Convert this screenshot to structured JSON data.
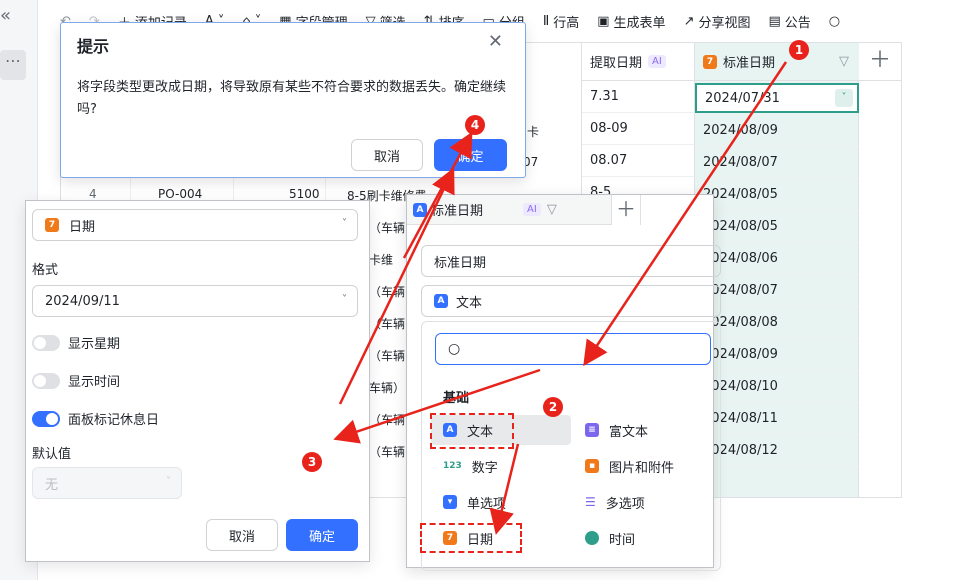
{
  "rail": {
    "collapse_icon": "«",
    "more_icon": "⋯"
  },
  "toolbar": {
    "items": [
      "添加记录",
      "字段管理",
      "筛选",
      "排序",
      "分组",
      "行高",
      "生成表单",
      "分享视图",
      "公告"
    ]
  },
  "grid": {
    "col_extract": "提取日期",
    "col_standard": "标准日期",
    "ai_tag": "AI",
    "rows": [
      {
        "extract": "7.31",
        "standard": "2024/07/31"
      },
      {
        "extract": "08-09",
        "standard": "2024/08/09"
      },
      {
        "extract": "08.07",
        "standard": "2024/08/07"
      },
      {
        "extract": "8-5",
        "standard": "2024/08/05"
      },
      {
        "extract": "",
        "standard": "2024/08/05"
      },
      {
        "extract": "",
        "standard": "2024/08/06"
      },
      {
        "extract": "",
        "standard": "2024/08/07"
      },
      {
        "extract": "",
        "standard": "2024/08/08"
      },
      {
        "extract": "",
        "standard": "2024/08/09"
      },
      {
        "extract": "",
        "standard": "2024/08/10"
      },
      {
        "extract": "",
        "standard": "2024/08/11"
      },
      {
        "extract": "",
        "standard": "2024/08/12"
      }
    ],
    "partial_row": {
      "index": "4",
      "po": "PO-004",
      "amount": "5100",
      "desc": "8-5刷卡维修费"
    },
    "partial_cells": [
      "卡",
      "07",
      "则（车辆",
      "刷卡维",
      "则（车辆",
      "则（车辆",
      "则（车辆",
      "（车辆）",
      "则（车辆",
      "则（车辆",
      "则（车辆"
    ]
  },
  "dialog": {
    "title": "提示",
    "message": "将字段类型更改成日期，将导致原有某些不符合要求的数据丢失。确定继续吗?",
    "cancel": "取消",
    "confirm": "确定"
  },
  "settings_panel": {
    "type_label": "日期",
    "format_heading": "格式",
    "format_value": "2024/09/11",
    "toggle_weekday": "显示星期",
    "toggle_time": "显示时间",
    "toggle_holiday": "面板标记休息日",
    "default_heading": "默认值",
    "default_value": "无",
    "cancel": "取消",
    "confirm": "确定"
  },
  "type_panel": {
    "header_title": "标准日期",
    "ai_tag": "AI",
    "name_value": "标准日期",
    "current_type": "文本",
    "search_placeholder": "",
    "section_basic": "基础",
    "types": {
      "text": "文本",
      "rich_text": "富文本",
      "number": "数字",
      "attachment": "图片和附件",
      "single_select": "单选项",
      "multi_select": "多选项",
      "date": "日期",
      "time": "时间"
    },
    "number_icon_text": "123"
  },
  "markers": [
    "1",
    "2",
    "3",
    "4"
  ],
  "colors": {
    "accent": "#3370ff",
    "marker": "#e8231c",
    "selected_col": "#e8f4f1",
    "ai_purple": "#8a6cf0",
    "date_orange": "#f07a1a"
  }
}
